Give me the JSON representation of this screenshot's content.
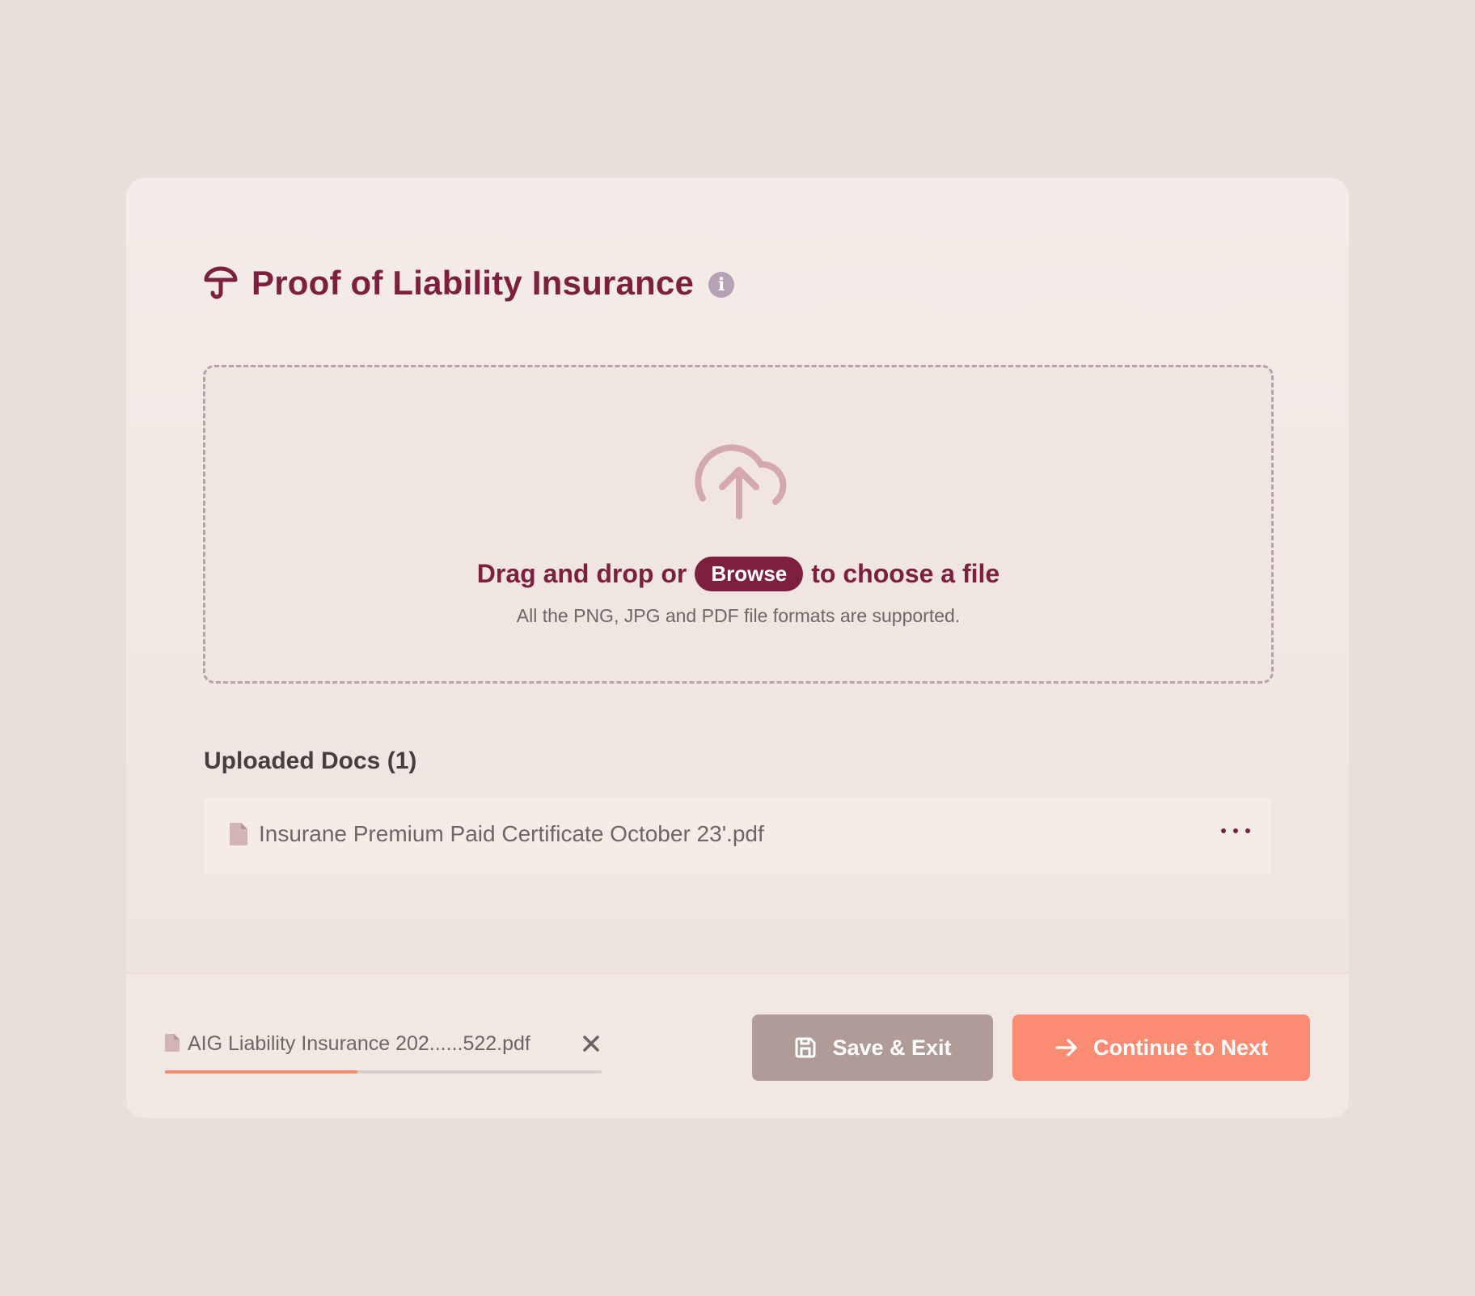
{
  "header": {
    "title": "Proof of Liability Insurance",
    "title_icon": "umbrella-icon",
    "info_icon": "info-icon",
    "info_glyph": "i"
  },
  "dropzone": {
    "icon": "cloud-upload-icon",
    "text_before": "Drag and drop or",
    "browse_label": "Browse",
    "text_after": "to choose a file",
    "supported_formats": "All the PNG, JPG and PDF file formats are supported."
  },
  "uploaded": {
    "title": "Uploaded Docs (1)",
    "items": [
      {
        "name": "Insurane Premium Paid Certificate October 23'.pdf",
        "icon": "file-icon",
        "menu_icon": "more-options-icon"
      }
    ]
  },
  "footer": {
    "uploading_file": {
      "name": "AIG Liability Insurance 202......522.pdf",
      "progress": 0.44,
      "icon": "file-icon",
      "cancel_icon": "close-icon"
    },
    "save_label": "Save & Exit",
    "continue_label": "Continue to Next"
  },
  "colors": {
    "background": "#e9dfda",
    "primary": "#7d1f3e",
    "accent": "#f98c72",
    "muted_button": "#b09b96"
  }
}
